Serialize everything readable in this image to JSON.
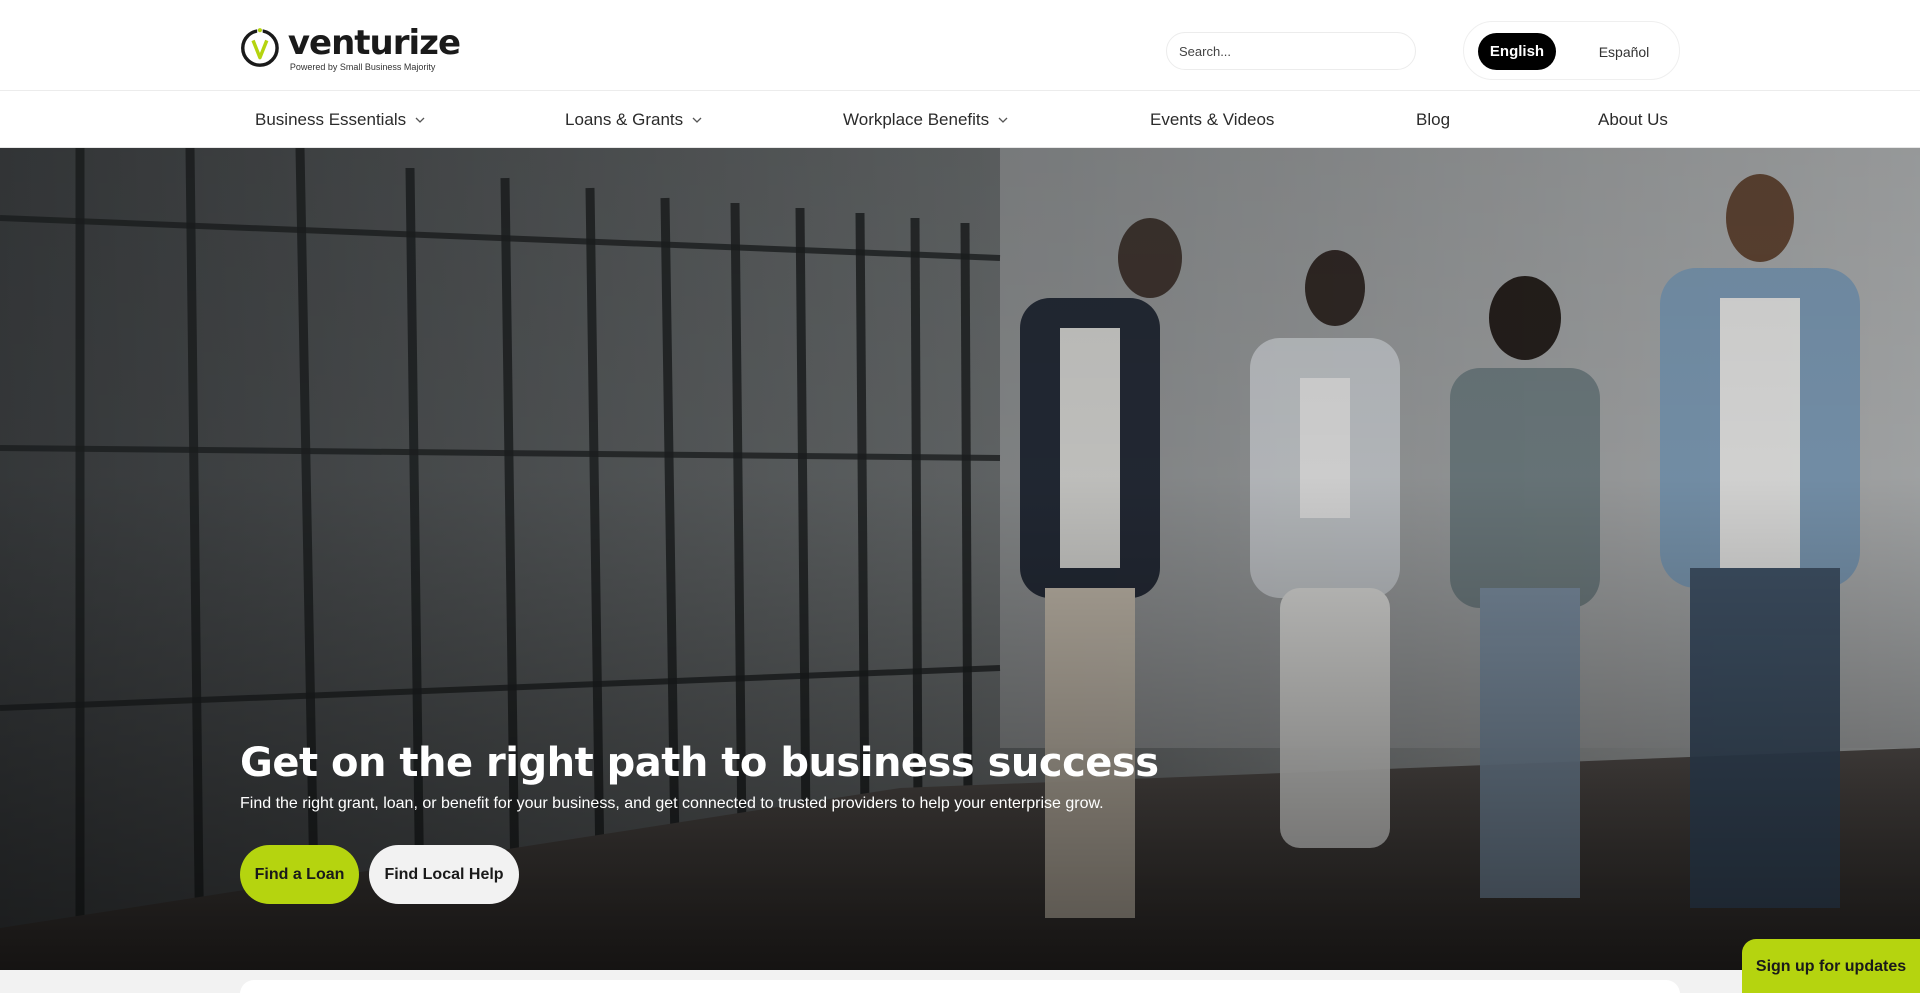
{
  "brand": {
    "name": "venturize",
    "tagline": "Powered by Small Business Majority",
    "logo_letter": "V",
    "accent_color": "#b5d40f"
  },
  "search": {
    "placeholder": "Search..."
  },
  "language": {
    "options": [
      "English",
      "Español"
    ],
    "selected": "English"
  },
  "nav": {
    "items": [
      {
        "label": "Business Essentials",
        "has_dropdown": true
      },
      {
        "label": "Loans & Grants",
        "has_dropdown": true
      },
      {
        "label": "Workplace Benefits",
        "has_dropdown": true
      },
      {
        "label": "Events & Videos",
        "has_dropdown": false
      },
      {
        "label": "Blog",
        "has_dropdown": false
      },
      {
        "label": "About Us",
        "has_dropdown": false
      }
    ]
  },
  "hero": {
    "title": "Get on the right path to business success",
    "subtitle": "Find the right grant, loan, or benefit for your business, and get connected to trusted providers to help your enterprise grow.",
    "primary_button": "Find a Loan",
    "secondary_button": "Find Local Help",
    "image_icon": "people-walking-office-photo"
  },
  "signup": {
    "label": "Sign up for updates"
  },
  "icons": {
    "chevron": "chevron-down-icon"
  }
}
